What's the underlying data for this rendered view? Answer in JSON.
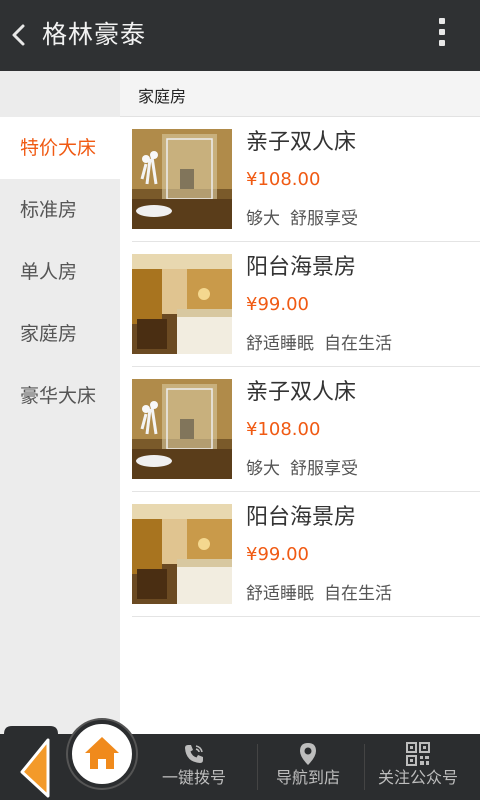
{
  "header": {
    "title": "格林豪泰",
    "back_icon": "chevron-left-icon",
    "menu_icon": "more-vertical-icon"
  },
  "sidebar": {
    "items": [
      {
        "label": "特价大床",
        "active": true
      },
      {
        "label": "标准房",
        "active": false
      },
      {
        "label": "单人房",
        "active": false
      },
      {
        "label": "家庭房",
        "active": false
      },
      {
        "label": "豪华大床",
        "active": false
      }
    ]
  },
  "section": {
    "title": "家庭房"
  },
  "rooms": [
    {
      "name": "亲子双人床",
      "price": "¥108.00",
      "tags": [
        "够大",
        "舒服享受"
      ],
      "thumb": "bathroom-photo"
    },
    {
      "name": "阳台海景房",
      "price": "¥99.00",
      "tags": [
        "舒适睡眠",
        "自在生活"
      ],
      "thumb": "bedroom-photo"
    },
    {
      "name": "亲子双人床",
      "price": "¥108.00",
      "tags": [
        "够大",
        "舒服享受"
      ],
      "thumb": "bathroom-photo"
    },
    {
      "name": "阳台海景房",
      "price": "¥99.00",
      "tags": [
        "舒适睡眠",
        "自在生活"
      ],
      "thumb": "bedroom-photo"
    }
  ],
  "bottom_nav": {
    "home_icon": "home-icon",
    "items": [
      {
        "label": "一键拨号",
        "icon": "phone-icon"
      },
      {
        "label": "导航到店",
        "icon": "location-pin-icon"
      },
      {
        "label": "关注公众号",
        "icon": "qr-code-icon"
      }
    ]
  },
  "colors": {
    "accent": "#f05a13",
    "topbar": "#2f3133",
    "sidebar": "#ececec",
    "bottombar": "#2b2d2f"
  }
}
